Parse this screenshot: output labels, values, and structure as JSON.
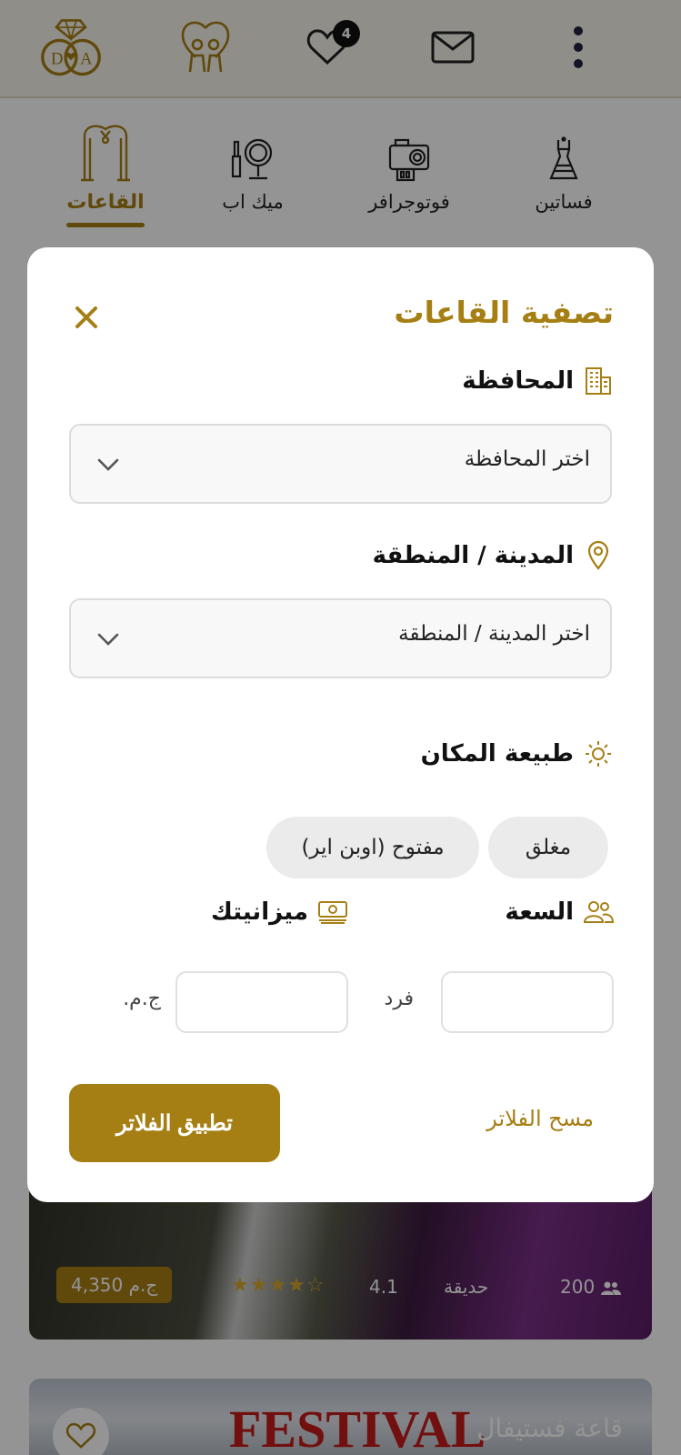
{
  "topbar": {
    "logo_text": "DA",
    "wishlist_count": "4",
    "icons": [
      "ring-logo-icon",
      "couple-icon",
      "heart-icon",
      "mail-icon",
      "more-vertical-icon"
    ]
  },
  "categories": [
    {
      "label": "القاعات",
      "icon": "wedding-arch-icon",
      "active": true
    },
    {
      "label": "ميك اب",
      "icon": "makeup-mirror-icon",
      "active": false
    },
    {
      "label": "فوتوجرافر",
      "icon": "camera-icon",
      "active": false
    },
    {
      "label": "فساتين",
      "icon": "dress-icon",
      "active": false
    }
  ],
  "venues": [
    {
      "price": "4,350 ج.م",
      "stars": "★★★★☆",
      "rating": "4.1",
      "type": "حديقة",
      "capacity": "200"
    },
    {
      "name": "قاعة فستيفال",
      "sign_text": "FESTIVAL"
    }
  ],
  "filter": {
    "title": "تصفية القاعات",
    "governorate": {
      "label": "المحافظة",
      "value": "اختر المحافظة"
    },
    "city": {
      "label": "المدينة / المنطقة",
      "value": "اختر المدينة / المنطقة"
    },
    "venue_type": {
      "label": "طبيعة المكان",
      "options": [
        "مغلق",
        "مفتوح (اوبن اير)"
      ]
    },
    "capacity": {
      "label": "السعة",
      "unit": "فرد",
      "value": ""
    },
    "budget": {
      "label": "ميزانيتك",
      "unit": "ج.م.",
      "value": ""
    },
    "apply_label": "تطبيق الفلاتر",
    "clear_label": "مسح الفلاتر"
  },
  "colors": {
    "accent": "#a67f14",
    "topbar_bg": "#f7f5ec"
  }
}
